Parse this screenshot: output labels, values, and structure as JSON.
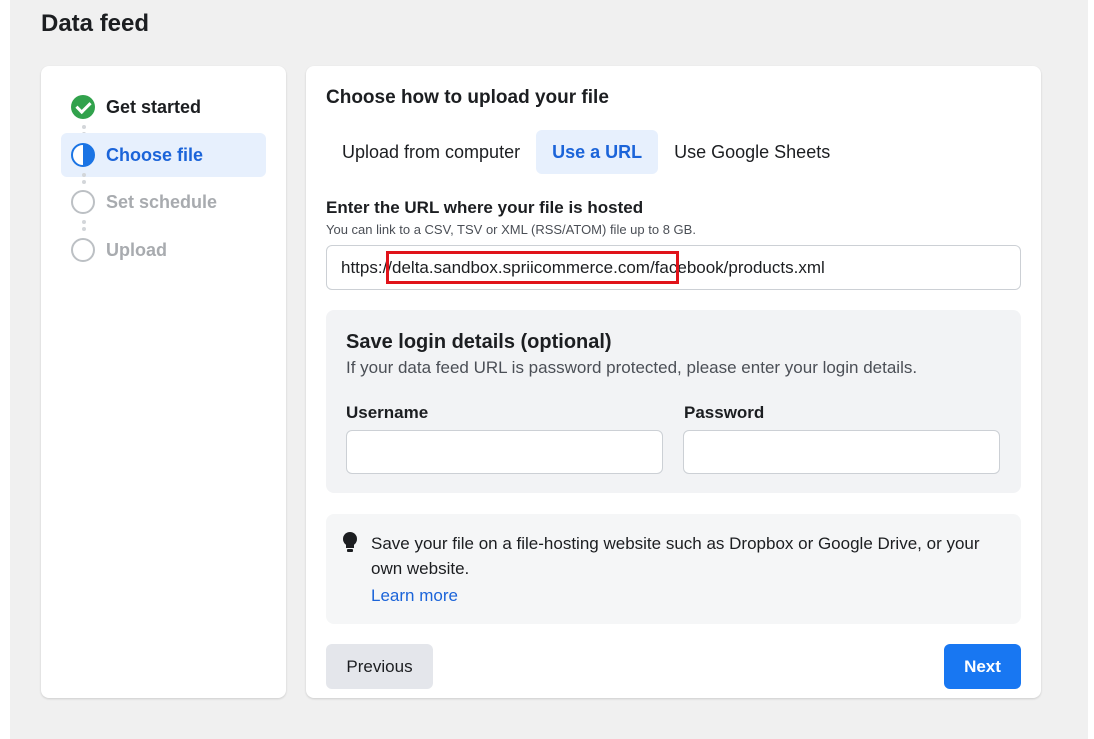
{
  "page": {
    "title": "Data feed"
  },
  "steps": [
    {
      "label": "Get started",
      "state": "done"
    },
    {
      "label": "Choose file",
      "state": "active"
    },
    {
      "label": "Set schedule",
      "state": "todo"
    },
    {
      "label": "Upload",
      "state": "todo"
    }
  ],
  "upload": {
    "title": "Choose how to upload your file",
    "tabs": [
      "Upload from computer",
      "Use a URL",
      "Use Google Sheets"
    ],
    "active_tab": "Use a URL",
    "url_label": "Enter the URL where your file is hosted",
    "url_help": "You can link to a CSV, TSV or XML (RSS/ATOM) file up to 8 GB.",
    "url_value": "https://delta.sandbox.spriicommerce.com/facebook/products.xml"
  },
  "login": {
    "title": "Save login details (optional)",
    "subtitle": "If your data feed URL is password protected, please enter your login details.",
    "username_label": "Username",
    "username_value": "",
    "password_label": "Password",
    "password_value": ""
  },
  "tip": {
    "icon": "lightbulb-icon",
    "text": "Save your file on a file-hosting website such as Dropbox or Google Drive, or your own website.",
    "link": "Learn more"
  },
  "actions": {
    "previous": "Previous",
    "next": "Next"
  },
  "colors": {
    "accent": "#1877f2",
    "accent_text": "#1b64d9",
    "success": "#31a24c",
    "annotation": "#e0131a",
    "background": "#f0f0f0"
  }
}
